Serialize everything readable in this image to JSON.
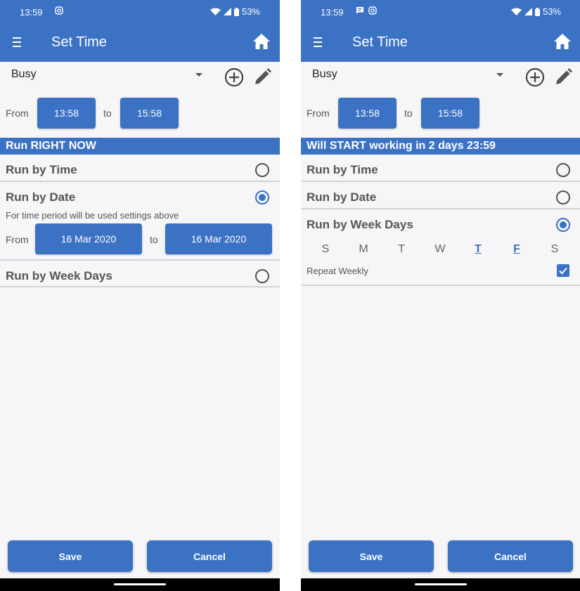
{
  "colors": {
    "accent": "#3b72c4",
    "text": "#555555",
    "background": "#f6f6f8",
    "divider": "#d3d3d8"
  },
  "screens": [
    {
      "status_time": "13:59",
      "status_battery": "53%",
      "status_icons_left": [
        "instagram-icon"
      ],
      "title": "Set Time",
      "profile": "Busy",
      "from_label": "From",
      "to_label": "to",
      "time_from": "13:58",
      "time_to": "15:58",
      "banner": "Run RIGHT NOW",
      "options": [
        {
          "label": "Run by Time",
          "selected": false
        },
        {
          "label": "Run by Date",
          "selected": true
        },
        {
          "label": "Run by Week Days",
          "selected": false
        }
      ],
      "date_hint": "For time period will be used settings above",
      "date_from": "16 Mar 2020",
      "date_to": "16 Mar 2020",
      "save_label": "Save",
      "cancel_label": "Cancel"
    },
    {
      "status_time": "13:59",
      "status_battery": "53%",
      "status_icons_left": [
        "message-icon",
        "instagram-icon"
      ],
      "title": "Set Time",
      "profile": "Busy",
      "from_label": "From",
      "to_label": "to",
      "time_from": "13:58",
      "time_to": "15:58",
      "banner": "Will START working in 2 days 23:59",
      "options": [
        {
          "label": "Run by Time",
          "selected": false
        },
        {
          "label": "Run by Date",
          "selected": false
        },
        {
          "label": "Run by Week Days",
          "selected": true
        }
      ],
      "weekdays": [
        {
          "label": "S",
          "selected": false
        },
        {
          "label": "M",
          "selected": false
        },
        {
          "label": "T",
          "selected": false
        },
        {
          "label": "W",
          "selected": false
        },
        {
          "label": "T",
          "selected": true
        },
        {
          "label": "F",
          "selected": true
        },
        {
          "label": "S",
          "selected": false
        }
      ],
      "repeat_label": "Repeat Weekly",
      "repeat_checked": true,
      "save_label": "Save",
      "cancel_label": "Cancel"
    }
  ]
}
